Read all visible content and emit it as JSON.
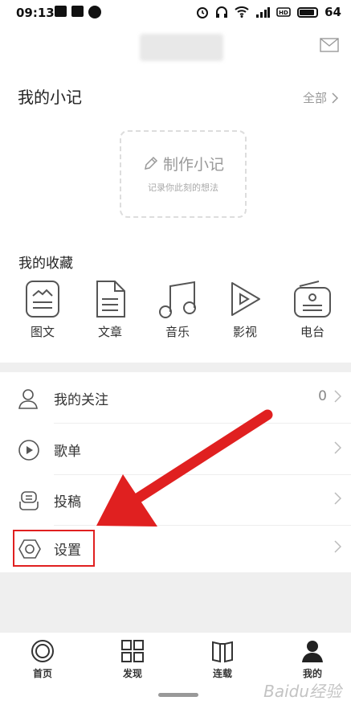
{
  "status": {
    "time": "09:13",
    "battery": "64"
  },
  "notes": {
    "title": "我的小记",
    "all_label": "全部",
    "make_note": "制作小记",
    "make_note_sub": "记录你此刻的想法"
  },
  "favorites": {
    "title": "我的收藏",
    "items": [
      {
        "label": "图文",
        "icon": "image-text-icon"
      },
      {
        "label": "文章",
        "icon": "article-icon"
      },
      {
        "label": "音乐",
        "icon": "music-icon"
      },
      {
        "label": "影视",
        "icon": "video-icon"
      },
      {
        "label": "电台",
        "icon": "radio-icon"
      }
    ]
  },
  "menu": [
    {
      "label": "我的关注",
      "value": "0",
      "icon": "user-icon"
    },
    {
      "label": "歌单",
      "value": "",
      "icon": "play-circle-icon"
    },
    {
      "label": "投稿",
      "value": "",
      "icon": "submit-icon"
    },
    {
      "label": "设置",
      "value": "",
      "icon": "hexagon-settings-icon"
    }
  ],
  "tabs": [
    {
      "label": "首页",
      "icon": "home-icon"
    },
    {
      "label": "发现",
      "icon": "grid-icon"
    },
    {
      "label": "连载",
      "icon": "book-icon"
    },
    {
      "label": "我的",
      "icon": "profile-icon",
      "active": true
    }
  ],
  "watermark": "Baidu经验",
  "colors": {
    "highlight": "#e02020",
    "text": "#333333",
    "muted": "#999999"
  }
}
